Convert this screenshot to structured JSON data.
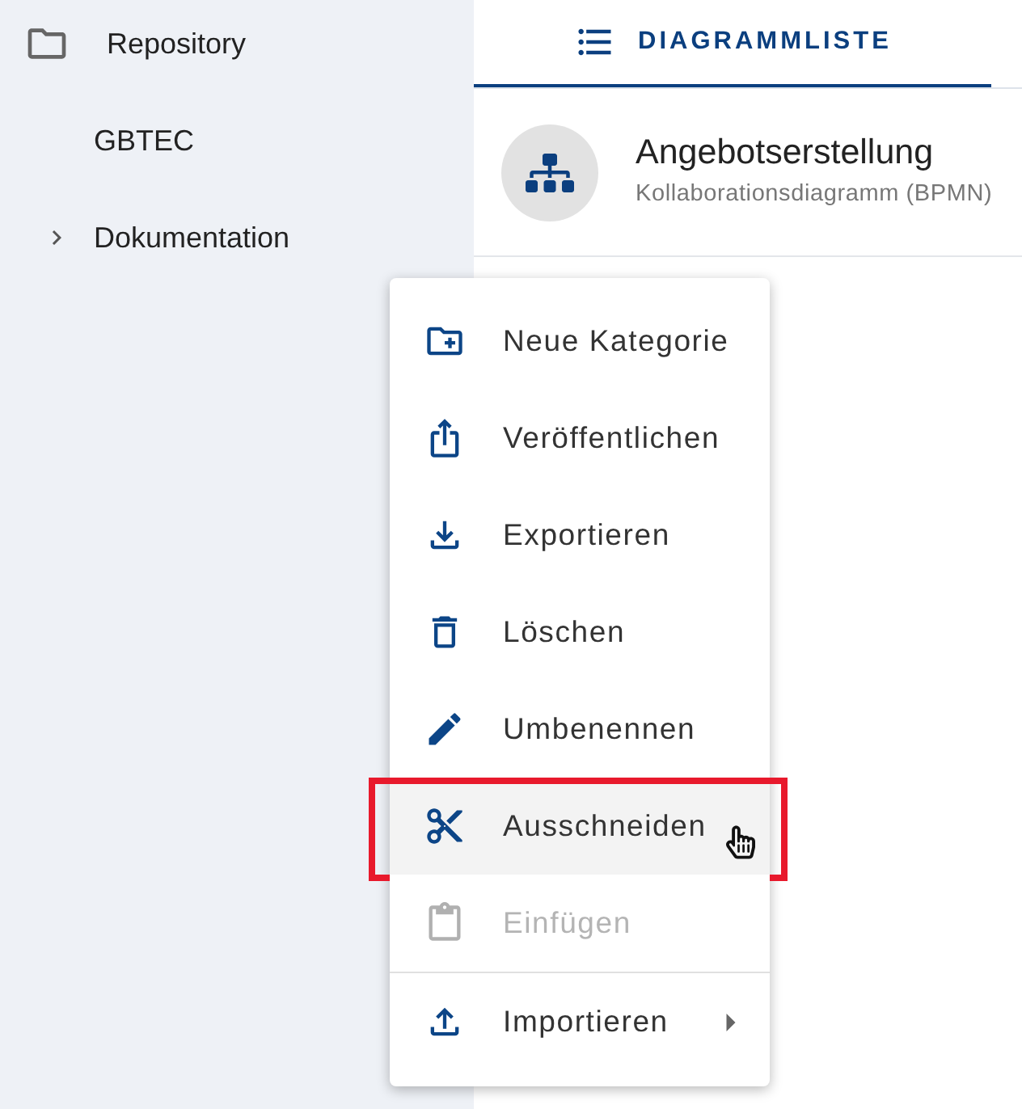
{
  "sidebar": {
    "items": [
      {
        "label": "Repository",
        "children": [
          {
            "label": "GBTEC",
            "has_children": false
          },
          {
            "label": "Dokumentation",
            "has_children": true,
            "expanded": false
          }
        ]
      }
    ]
  },
  "tabs": [
    {
      "label": "DIAGRAMMLISTE",
      "selected": true
    }
  ],
  "diagrams": [
    {
      "title": "Angebotserstellung",
      "subtitle": "Kollaborationsdiagramm (BPMN)"
    }
  ],
  "context_menu": {
    "groups": [
      {
        "items": [
          {
            "label": "Neue Kategorie",
            "disabled": false,
            "hovered": false,
            "framed": false,
            "submenu": false
          },
          {
            "label": "Veröffentlichen",
            "disabled": false,
            "hovered": false,
            "framed": false,
            "submenu": false
          },
          {
            "label": "Exportieren",
            "disabled": false,
            "hovered": false,
            "framed": false,
            "submenu": false
          },
          {
            "label": "Löschen",
            "disabled": false,
            "hovered": false,
            "framed": false,
            "submenu": false
          },
          {
            "label": "Umbenennen",
            "disabled": false,
            "hovered": false,
            "framed": false,
            "submenu": false
          },
          {
            "label": "Ausschneiden",
            "disabled": false,
            "hovered": true,
            "framed": true,
            "submenu": false
          },
          {
            "label": "Einfügen",
            "disabled": true,
            "hovered": false,
            "framed": false,
            "submenu": false
          }
        ]
      },
      {
        "items": [
          {
            "label": "Importieren",
            "disabled": false,
            "hovered": false,
            "framed": false,
            "submenu": true
          }
        ]
      }
    ]
  }
}
